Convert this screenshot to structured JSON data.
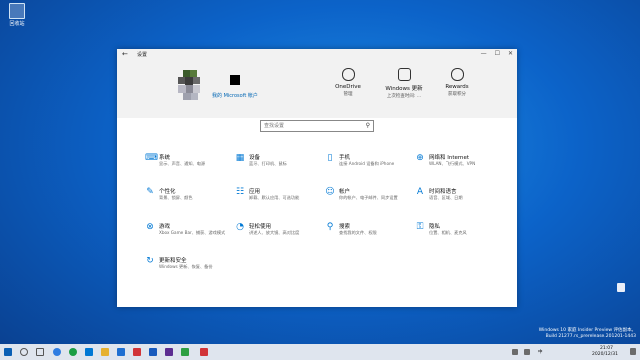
{
  "desktop": {
    "recycle_label": "回收站"
  },
  "window": {
    "title": "设置",
    "minimize": "—",
    "maximize": "☐",
    "close": "✕"
  },
  "header": {
    "account_link": "我的 Microsoft 帐户",
    "items": [
      {
        "title": "OneDrive",
        "subtitle": "管理",
        "icon": "cloud-icon"
      },
      {
        "title": "Windows 更新",
        "subtitle": "上次检查时间: ...",
        "icon": "update-icon"
      },
      {
        "title": "Rewards",
        "subtitle": "获取积分",
        "icon": "medal-icon"
      }
    ]
  },
  "search": {
    "placeholder": "查找设置"
  },
  "categories": [
    {
      "title": "系统",
      "subtitle": "显示、声音、通知、电源",
      "icon": "⌨"
    },
    {
      "title": "设备",
      "subtitle": "蓝牙、打印机、鼠标",
      "icon": "▦"
    },
    {
      "title": "手机",
      "subtitle": "连接 Android 设备和 iPhone",
      "icon": "▯"
    },
    {
      "title": "网络和 Internet",
      "subtitle": "WLAN、飞行模式、VPN",
      "icon": "⊕"
    },
    {
      "title": "个性化",
      "subtitle": "背景、锁屏、颜色",
      "icon": "✎"
    },
    {
      "title": "应用",
      "subtitle": "卸载、默认应用、可选功能",
      "icon": "☷"
    },
    {
      "title": "帐户",
      "subtitle": "你的帐户、电子邮件、同步设置",
      "icon": "☺"
    },
    {
      "title": "时间和语言",
      "subtitle": "语音、区域、日期",
      "icon": "A"
    },
    {
      "title": "游戏",
      "subtitle": "Xbox Game Bar、捕获、游戏模式",
      "icon": "⊗"
    },
    {
      "title": "轻松使用",
      "subtitle": "讲述人、放大镜、高对比度",
      "icon": "◔"
    },
    {
      "title": "搜索",
      "subtitle": "查找我的文件、权限",
      "icon": "⚲"
    },
    {
      "title": "隐私",
      "subtitle": "位置、相机、麦克风",
      "icon": "⚿"
    },
    {
      "title": "更新和安全",
      "subtitle": "Windows 更新、恢复、备份",
      "icon": "↻"
    }
  ],
  "watermark": {
    "line1": "Windows 10 家庭 Insider Preview 评估副本。",
    "line2": "Build 21277.rs_prerelease.201201-1443"
  },
  "taskbar": {
    "time": "21:07",
    "date": "2020/12/31",
    "lang": "中",
    "colors": {
      "edge": "#2f7de1",
      "chrome": "#1a9e44",
      "store": "#0078d4",
      "folder": "#e6b130",
      "mail": "#1f6fd1",
      "red": "#d13438",
      "word": "#185abd",
      "tiles": "#5c2d91",
      "green": "#2ea043",
      "gray": "#6b6b6b"
    }
  }
}
